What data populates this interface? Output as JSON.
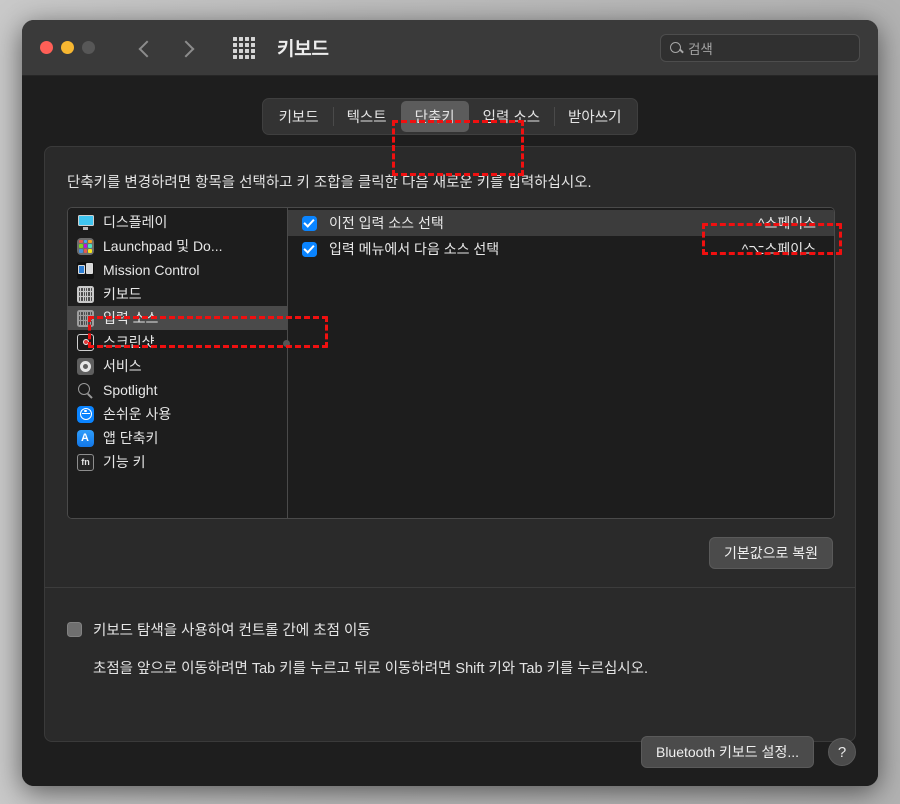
{
  "window": {
    "title": "키보드",
    "search": {
      "placeholder": "검색",
      "icon": "search-icon"
    },
    "traffic": {
      "close": "close-button",
      "minimize": "minimize-button",
      "zoom": "zoom-button"
    },
    "nav": {
      "back": "back-chevron-icon",
      "forward": "forward-chevron-icon",
      "grid": "grid-icon"
    }
  },
  "tabs": [
    {
      "label": "키보드",
      "active": false
    },
    {
      "label": "텍스트",
      "active": false
    },
    {
      "label": "단축키",
      "active": true
    },
    {
      "label": "입력 소스",
      "active": false
    },
    {
      "label": "받아쓰기",
      "active": false
    }
  ],
  "content": {
    "description": "단축키를 변경하려면 항목을 선택하고 키 조합을 클릭한 다음 새로운 키를 입력하십시오."
  },
  "categories": [
    {
      "label": "디스플레이",
      "icon": "display-icon",
      "selected": false
    },
    {
      "label": "Launchpad 및 Do...",
      "icon": "launchpad-icon",
      "selected": false
    },
    {
      "label": "Mission Control",
      "icon": "mission-control-icon",
      "selected": false
    },
    {
      "label": "키보드",
      "icon": "keyboard-icon",
      "selected": false
    },
    {
      "label": "입력 소스",
      "icon": "input-source-icon",
      "selected": true
    },
    {
      "label": "스크린샷",
      "icon": "screenshot-icon",
      "selected": false
    },
    {
      "label": "서비스",
      "icon": "services-gear-icon",
      "selected": false
    },
    {
      "label": "Spotlight",
      "icon": "spotlight-icon",
      "selected": false
    },
    {
      "label": "손쉬운 사용",
      "icon": "accessibility-icon",
      "selected": false
    },
    {
      "label": "앱 단축키",
      "icon": "app-shortcuts-icon",
      "selected": false
    },
    {
      "label": "기능 키",
      "icon": "function-key-icon",
      "selected": false
    }
  ],
  "shortcuts": [
    {
      "label": "이전 입력 소스 선택",
      "keys": "^스페이스",
      "checked": true,
      "highlighted": true
    },
    {
      "label": "입력 메뉴에서 다음 소스 선택",
      "keys": "^⌥스페이스",
      "checked": true,
      "highlighted": false
    }
  ],
  "buttons": {
    "restore_defaults": "기본값으로 복원",
    "bluetooth_keyboard": "Bluetooth 키보드 설정...",
    "help": "?"
  },
  "focus": {
    "checkbox_label": "키보드 탐색을 사용하여 컨트롤 간에 초점 이동",
    "checked": false,
    "help_text": "초점을 앞으로 이동하려면 Tab 키를 누르고 뒤로 이동하려면 Shift 키와 Tab 키를 누르십시오."
  },
  "annotations": {
    "accent": "#f01010",
    "boxes": [
      "tab-shortcuts-highlight",
      "shortcut-keys-highlight",
      "category-input-source-highlight"
    ]
  }
}
